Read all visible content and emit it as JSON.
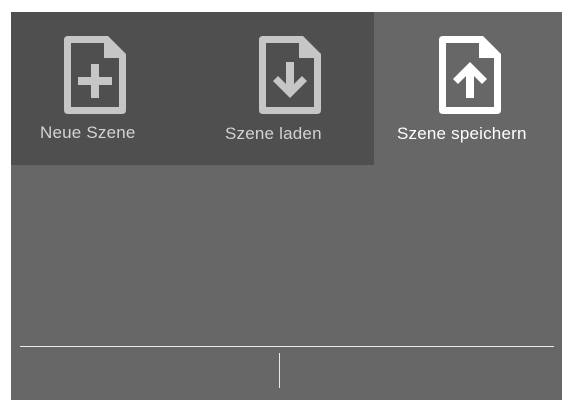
{
  "tabs": [
    {
      "label": "Neue Szene",
      "icon": "file-plus-icon",
      "active": false
    },
    {
      "label": "Szene laden",
      "icon": "file-download-icon",
      "active": false
    },
    {
      "label": "Szene speichern",
      "icon": "file-upload-icon",
      "active": true
    }
  ],
  "footer": {
    "left_label": "",
    "right_label": ""
  },
  "colors": {
    "panel_bg": "#676767",
    "inactive_tab_bg": "#4f4f4f",
    "inactive_text": "#d2d2d2",
    "active_text": "#ffffff",
    "divider": "#e9e9e9"
  }
}
